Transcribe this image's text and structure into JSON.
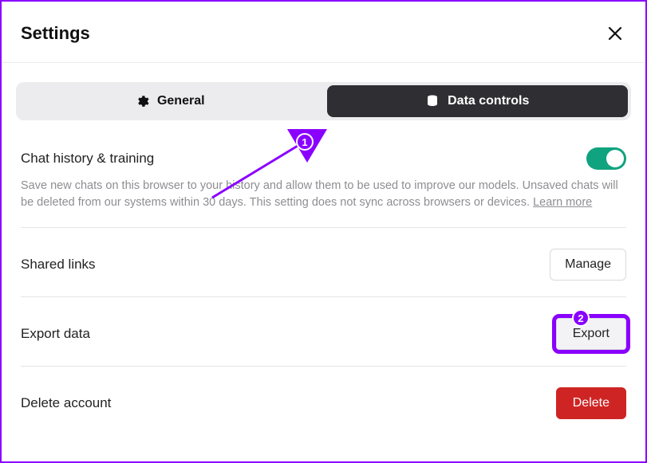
{
  "header": {
    "title": "Settings"
  },
  "tabs": {
    "general": "General",
    "data_controls": "Data controls"
  },
  "chat_training": {
    "label": "Chat history & training",
    "description_prefix": "Save new chats on this browser to your history and allow them to be used to improve our models. Unsaved chats will be deleted from our systems within 30 days. This setting does not sync across browsers or devices. ",
    "learn_more": "Learn more",
    "toggle_on": true
  },
  "shared_links": {
    "label": "Shared links",
    "button": "Manage"
  },
  "export_data": {
    "label": "Export data",
    "button": "Export"
  },
  "delete_account": {
    "label": "Delete account",
    "button": "Delete"
  },
  "annotations": {
    "step1": "1",
    "step2": "2"
  }
}
